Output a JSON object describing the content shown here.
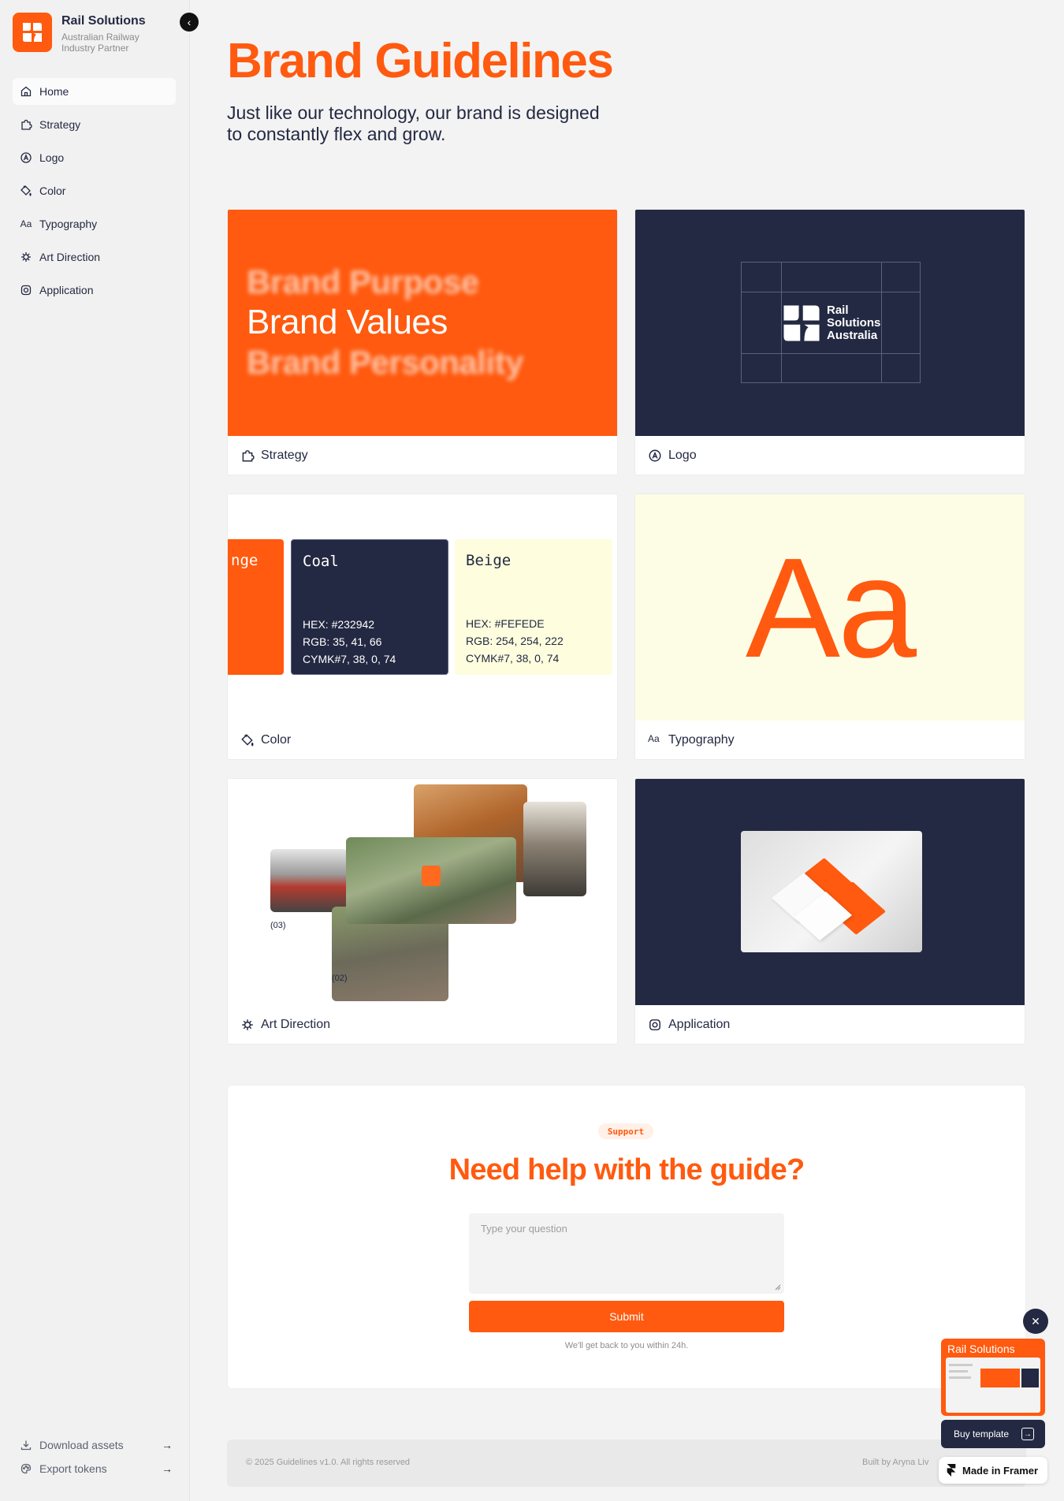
{
  "brand": {
    "name": "Rail Solutions",
    "subtitle": "Australian Railway Industry Partner"
  },
  "sidebar": {
    "items": [
      {
        "label": "Home",
        "icon": "home-icon",
        "active": true
      },
      {
        "label": "Strategy",
        "icon": "puzzle-icon"
      },
      {
        "label": "Logo",
        "icon": "logo-icon"
      },
      {
        "label": "Color",
        "icon": "paint-bucket-icon"
      },
      {
        "label": "Typography",
        "icon": "type-icon"
      },
      {
        "label": "Art Direction",
        "icon": "aperture-icon"
      },
      {
        "label": "Application",
        "icon": "app-icon"
      }
    ],
    "bottom": [
      {
        "label": "Download assets",
        "icon": "download-icon"
      },
      {
        "label": "Export tokens",
        "icon": "palette-icon"
      }
    ]
  },
  "page": {
    "title": "Brand Guidelines",
    "subtitle": "Just like our technology, our brand is designed to constantly flex and grow."
  },
  "cards": {
    "strategy": {
      "label": "Strategy",
      "blur_top": "Brand Purpose",
      "main": "Brand Values",
      "blur_bottom": "Brand Personality"
    },
    "logo": {
      "label": "Logo",
      "mark_text": [
        "Rail",
        "Solutions",
        "Australia"
      ]
    },
    "color": {
      "label": "Color",
      "swatches": [
        {
          "name": "Orange",
          "visible_name": "nge",
          "hex": "#FF5A0F"
        },
        {
          "name": "Coal",
          "hex_line": "HEX:  #232942",
          "rgb_line": "RGB:  35, 41, 66",
          "cymk_line": "CYMK#7, 38, 0, 74",
          "hex": "#232942"
        },
        {
          "name": "Beige",
          "hex_line": "HEX:  #FEFEDE",
          "rgb_line": "RGB:  254, 254, 222",
          "cymk_line": "CYMK#7, 38, 0, 74",
          "hex": "#FEFEDE"
        }
      ]
    },
    "typography": {
      "label": "Typography",
      "sample": "Aa"
    },
    "art": {
      "label": "Art Direction",
      "caption_a": "(03)",
      "caption_b": "(02)"
    },
    "application": {
      "label": "Application"
    }
  },
  "support": {
    "badge": "Support",
    "title": "Need help with the guide?",
    "placeholder": "Type your question",
    "submit": "Submit",
    "note": "We'll get back to you within 24h."
  },
  "footer": {
    "copyright": "© 2025 Guidelines v1.0. All rights reserved",
    "built": "Built by Aryna Liv"
  },
  "promo": {
    "thumb_title": "Rail Solutions",
    "buy": "Buy template",
    "framer": "Made in Framer"
  },
  "colors": {
    "accent": "#FF5A0F",
    "coal": "#232942",
    "beige": "#FEFEDE"
  }
}
